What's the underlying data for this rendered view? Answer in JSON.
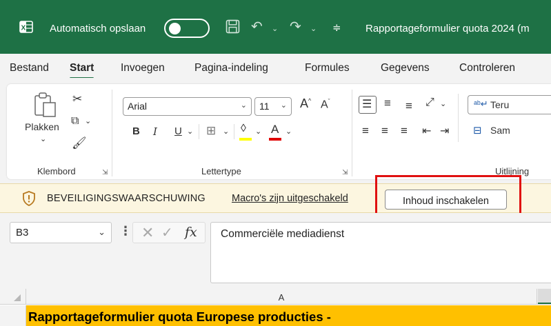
{
  "titlebar": {
    "autosave_label": "Automatisch opslaan",
    "autosave_state": "off",
    "document_title": "Rapportageformulier quota 2024 (m",
    "icons": [
      "excel-logo",
      "save-icon",
      "undo-icon",
      "redo-icon",
      "customize-qat-icon"
    ],
    "background_color": "#1e7145"
  },
  "tabs": [
    {
      "label": "Bestand"
    },
    {
      "label": "Start",
      "active": true
    },
    {
      "label": "Invoegen"
    },
    {
      "label": "Pagina-indeling"
    },
    {
      "label": "Formules"
    },
    {
      "label": "Gegevens"
    },
    {
      "label": "Controleren"
    }
  ],
  "ribbon": {
    "clipboard": {
      "label": "Klembord",
      "paste_label": "Plakken"
    },
    "font": {
      "label": "Lettertype",
      "font_name": "Arial",
      "font_size": "11",
      "bold": "B",
      "italic": "I",
      "underline": "U",
      "font_color_letter": "A",
      "grow_font": "A",
      "shrink_font": "A"
    },
    "alignment": {
      "label": "Uitlijning",
      "wrap_text": "Teru",
      "merge": "Sam"
    }
  },
  "security_bar": {
    "title": "BEVEILIGINGSWAARSCHUWING",
    "message": "Macro's zijn uitgeschakeld",
    "button_label": "Inhoud inschakelen",
    "highlight_color": "#e01010"
  },
  "formula_bar": {
    "name_box": "B3",
    "fx_label": "fx",
    "formula_value": "Commerciële mediadienst"
  },
  "grid": {
    "column_a": "A",
    "row1_value": "Rapportageformulier quota Europese producties -",
    "row1_fill": "#ffc000"
  }
}
